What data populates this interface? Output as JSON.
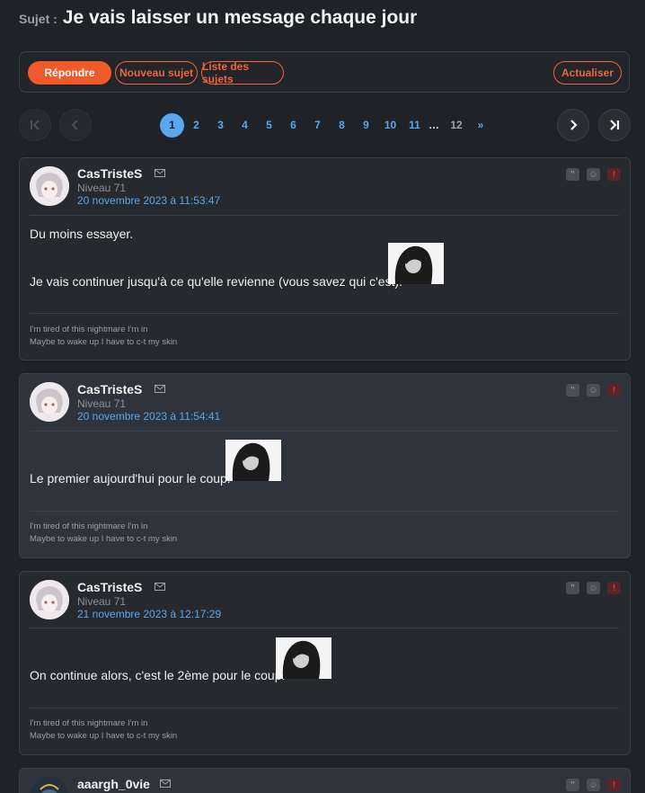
{
  "topic": {
    "prefix": "Sujet :",
    "title": "Je vais laisser un message chaque jour"
  },
  "toolbar": {
    "reply": "Répondre",
    "new_topic": "Nouveau sujet",
    "topic_list": "Liste des sujets",
    "refresh": "Actualiser"
  },
  "pagination": {
    "pages": [
      "1",
      "2",
      "3",
      "4",
      "5",
      "6",
      "7",
      "8",
      "9",
      "10",
      "11"
    ],
    "ellipsis": "…",
    "last_page": "12",
    "next": "»",
    "current": "1"
  },
  "posts": [
    {
      "author": "CasTristeS",
      "level": "Niveau 71",
      "date": "20 novembre 2023 à 11:53:47",
      "lines": [
        "Du moins essayer.",
        "Je vais continuer jusqu'à ce qu'elle revienne (vous savez qui c'est)."
      ],
      "signature": [
        "I'm tired of this nightmare I'm in",
        "Maybe to wake up I have to c-t my skin"
      ]
    },
    {
      "author": "CasTristeS",
      "level": "Niveau 71",
      "date": "20 novembre 2023 à 11:54:41",
      "lines": [
        "Le premier aujourd'hui pour le coup."
      ],
      "signature": [
        "I'm tired of this nightmare I'm in",
        "Maybe to wake up I have to c-t my skin"
      ]
    },
    {
      "author": "CasTristeS",
      "level": "Niveau 71",
      "date": "21 novembre 2023 à 12:17:29",
      "lines": [
        "On continue alors, c'est le 2ème pour le coup."
      ],
      "signature": [
        "I'm tired of this nightmare I'm in",
        "Maybe to wake up I have to c-t my skin"
      ]
    },
    {
      "author": "aaargh_0vie"
    }
  ],
  "icons": {
    "mail": "mail-icon",
    "quote": "quote-icon",
    "mp": "mp-icon",
    "report": "report-icon",
    "first": "first-page-icon",
    "prev": "prev-page-icon",
    "next": "next-page-icon",
    "last": "last-page-icon"
  },
  "colors": {
    "accent": "#f05a2a",
    "link": "#5aa6ef",
    "background": "#1f2226"
  }
}
